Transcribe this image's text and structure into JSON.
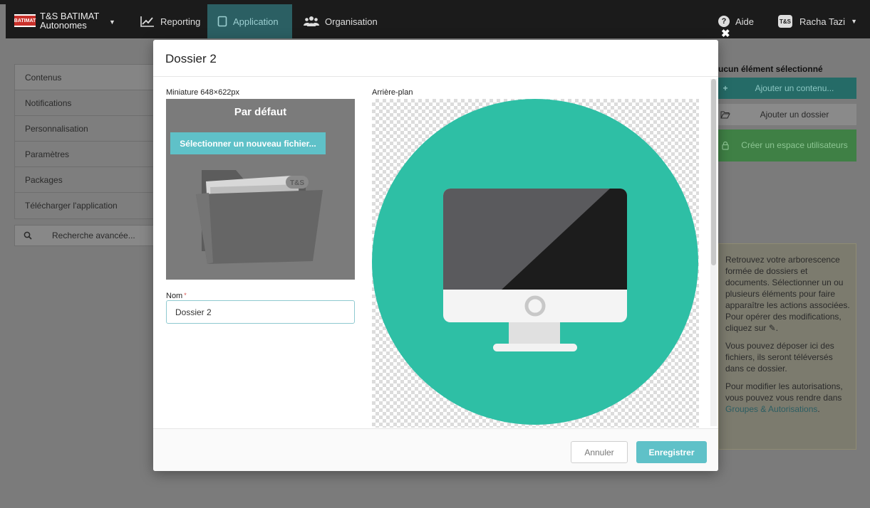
{
  "navbar": {
    "brand_logo": "BATIMAT",
    "brand_line1": "T&S BATIMAT",
    "brand_line2": "Autonomes",
    "items": [
      {
        "label": "Reporting",
        "icon": "line-chart-icon"
      },
      {
        "label": "Application",
        "icon": "tablet-icon",
        "active": true
      },
      {
        "label": "Organisation",
        "icon": "users-icon"
      }
    ],
    "help_label": "Aide",
    "avatar_initials": "T&S",
    "user_name": "Racha Tazi"
  },
  "sidebar": {
    "items": [
      {
        "label": "Contenus"
      },
      {
        "label": "Notifications"
      },
      {
        "label": "Personnalisation"
      },
      {
        "label": "Paramètres"
      },
      {
        "label": "Packages"
      },
      {
        "label": "Télécharger l'application"
      }
    ],
    "advanced_search": "Recherche avancée..."
  },
  "right_panel": {
    "title": "ucun élément sélectionné",
    "add_content": "Ajouter un contenu...",
    "add_folder": "Ajouter un dossier",
    "create_space": "Créer un espace utilisateurs",
    "info_p1": "Retrouvez votre arborescence formée de dossiers et documents. Sélectionner un ou plusieurs éléments pour faire apparaître les actions associées. Pour opérer des modifications, cliquez sur",
    "info_p1_end": ".",
    "info_p2": "Vous pouvez déposer ici des fichiers, ils seront téléversés dans ce dossier.",
    "info_p3": "Pour modifier les autorisations, vous pouvez vous rendre dans",
    "info_p3_link": "Groupes & Autorisations",
    "info_p3_end": "."
  },
  "modal": {
    "title": "Dossier 2",
    "thumbnail_label": "Miniature 648×622px",
    "thumbnail_default": "Par défaut",
    "select_file_button": "Sélectionner un nouveau fichier...",
    "folder_badge": "T&S",
    "background_label": "Arrière-plan",
    "name_label": "Nom",
    "name_required": "*",
    "name_value": "Dossier 2",
    "cancel_button": "Annuler",
    "save_button": "Enregistrer"
  },
  "colors": {
    "accent": "#5fc1c8",
    "monitor_circle": "#2ebfa5",
    "navbar": "#1b1b1b"
  }
}
